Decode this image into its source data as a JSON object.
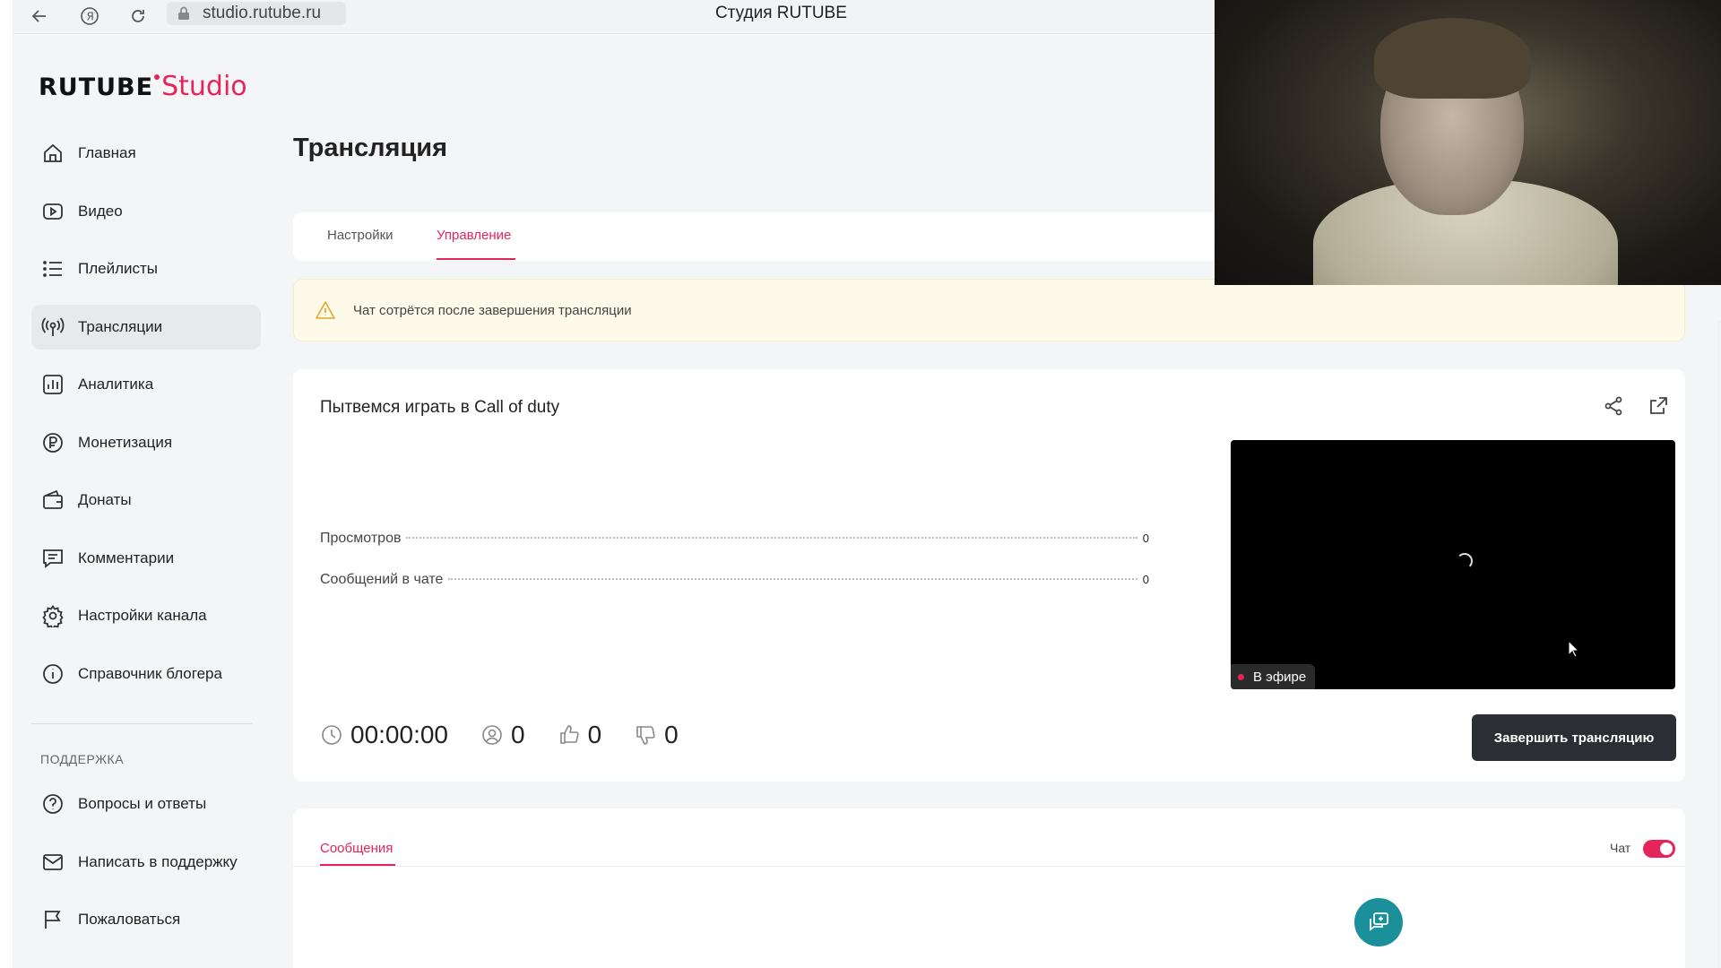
{
  "browser": {
    "url": "studio.rutube.ru",
    "title": "Студия RUTUBE"
  },
  "logo": {
    "brand": "RUTUBE",
    "product": "Studio"
  },
  "sidebar": {
    "items": [
      {
        "label": "Главная",
        "icon": "home-icon"
      },
      {
        "label": "Видео",
        "icon": "video-icon"
      },
      {
        "label": "Плейлисты",
        "icon": "playlist-icon"
      },
      {
        "label": "Трансляции",
        "icon": "broadcast-icon",
        "active": true
      },
      {
        "label": "Аналитика",
        "icon": "analytics-icon"
      },
      {
        "label": "Монетизация",
        "icon": "ruble-icon"
      },
      {
        "label": "Донаты",
        "icon": "wallet-icon"
      },
      {
        "label": "Комментарии",
        "icon": "comment-icon"
      },
      {
        "label": "Настройки канала",
        "icon": "gear-icon"
      },
      {
        "label": "Справочник блогера",
        "icon": "info-icon"
      }
    ],
    "support_title": "ПОДДЕРЖКА",
    "support_items": [
      {
        "label": "Вопросы и ответы",
        "icon": "question-icon"
      },
      {
        "label": "Написать в поддержку",
        "icon": "mail-icon"
      },
      {
        "label": "Пожаловаться",
        "icon": "flag-icon"
      }
    ]
  },
  "page": {
    "title": "Трансляция",
    "tabs": [
      {
        "label": "Настройки"
      },
      {
        "label": "Управление",
        "active": true
      }
    ],
    "warning": "Чат сотрётся после завершения трансляции"
  },
  "stream": {
    "title": "Пытвемся играть в Call of duty",
    "stats": [
      {
        "label": "Просмотров",
        "value": "0"
      },
      {
        "label": "Сообщений в чате",
        "value": "0"
      }
    ],
    "live_badge": "В эфире",
    "timer": "00:00:00",
    "viewers": "0",
    "likes": "0",
    "dislikes": "0",
    "end_button": "Завершить трансляцию"
  },
  "messages": {
    "tab": "Сообщения",
    "chat_label": "Чат",
    "chat_enabled": true
  },
  "colors": {
    "accent": "#e5245b",
    "dark_button": "#2b2f33",
    "help_fab": "#1b8f9a",
    "warning_bg": "#fdfae9"
  }
}
